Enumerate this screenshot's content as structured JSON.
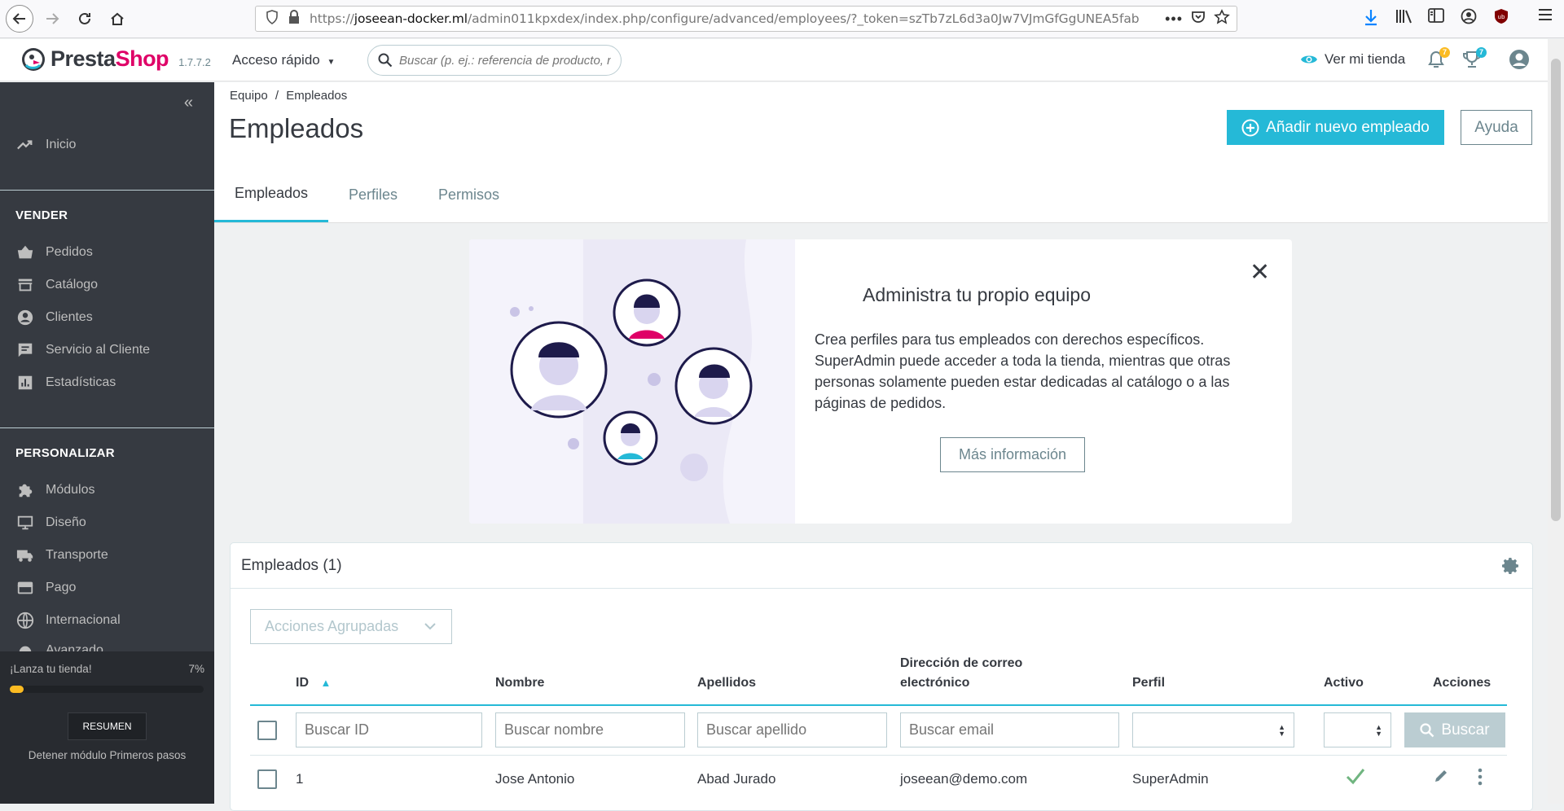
{
  "browser": {
    "url_prefix": "https://",
    "url_domain": "joseean-docker.ml",
    "url_path": "/admin011kpxdex/index.php/configure/advanced/employees/?_token=szTb7zL6d3a0Jw7VJmGfGgUNEA5fab"
  },
  "header": {
    "brand_a": "Presta",
    "brand_b": "Shop",
    "version": "1.7.7.2",
    "quick_access": "Acceso rápido",
    "search_placeholder": "Buscar (p. ej.: referencia de producto, nc",
    "view_shop": "Ver mi tienda",
    "notif_count": "7",
    "trophy_count": "7"
  },
  "sidebar": {
    "home": "Inicio",
    "section_sell": "VENDER",
    "sell_items": [
      "Pedidos",
      "Catálogo",
      "Clientes",
      "Servicio al Cliente",
      "Estadísticas"
    ],
    "section_custom": "PERSONALIZAR",
    "custom_items": [
      "Módulos",
      "Diseño",
      "Transporte",
      "Pago",
      "Internacional",
      "Avanzado"
    ],
    "onboarding_title": "¡Lanza tu tienda!",
    "onboarding_percent": "7%",
    "onboarding_progress": 0.07,
    "onboarding_button": "RESUMEN",
    "onboarding_stop": "Detener módulo Primeros pasos"
  },
  "page": {
    "breadcrumb_parent": "Equipo",
    "breadcrumb_sep": "/",
    "breadcrumb_current": "Empleados",
    "title": "Empleados",
    "add_button": "Añadir nuevo empleado",
    "help_button": "Ayuda",
    "tabs": [
      "Empleados",
      "Perfiles",
      "Permisos"
    ]
  },
  "banner": {
    "title": "Administra tu propio equipo",
    "text": "Crea perfiles para tus empleados con derechos específicos. SuperAdmin puede acceder a toda la tienda, mientras que otras personas solamente pueden estar dedicadas al catálogo o a las páginas de pedidos.",
    "more_button": "Más información"
  },
  "panel": {
    "title": "Empleados (1)",
    "bulk_actions": "Acciones Agrupadas",
    "columns": {
      "id": "ID",
      "first_name": "Nombre",
      "last_name": "Apellidos",
      "email_line1": "Dirección de correo",
      "email_line2": "electrónico",
      "profile": "Perfil",
      "active": "Activo",
      "actions": "Acciones"
    },
    "filters": {
      "id": "Buscar ID",
      "first_name": "Buscar nombre",
      "last_name": "Buscar apellido",
      "email": "Buscar email",
      "search_button": "Buscar"
    },
    "rows": [
      {
        "id": "1",
        "first_name": "Jose Antonio",
        "last_name": "Abad Jurado",
        "email": "joseean@demo.com",
        "profile": "SuperAdmin",
        "active": true
      }
    ]
  },
  "colors": {
    "accent": "#25b9d7",
    "sidebar_bg": "#363a41",
    "badge": "#fbbb22",
    "active_check": "#70b580"
  }
}
